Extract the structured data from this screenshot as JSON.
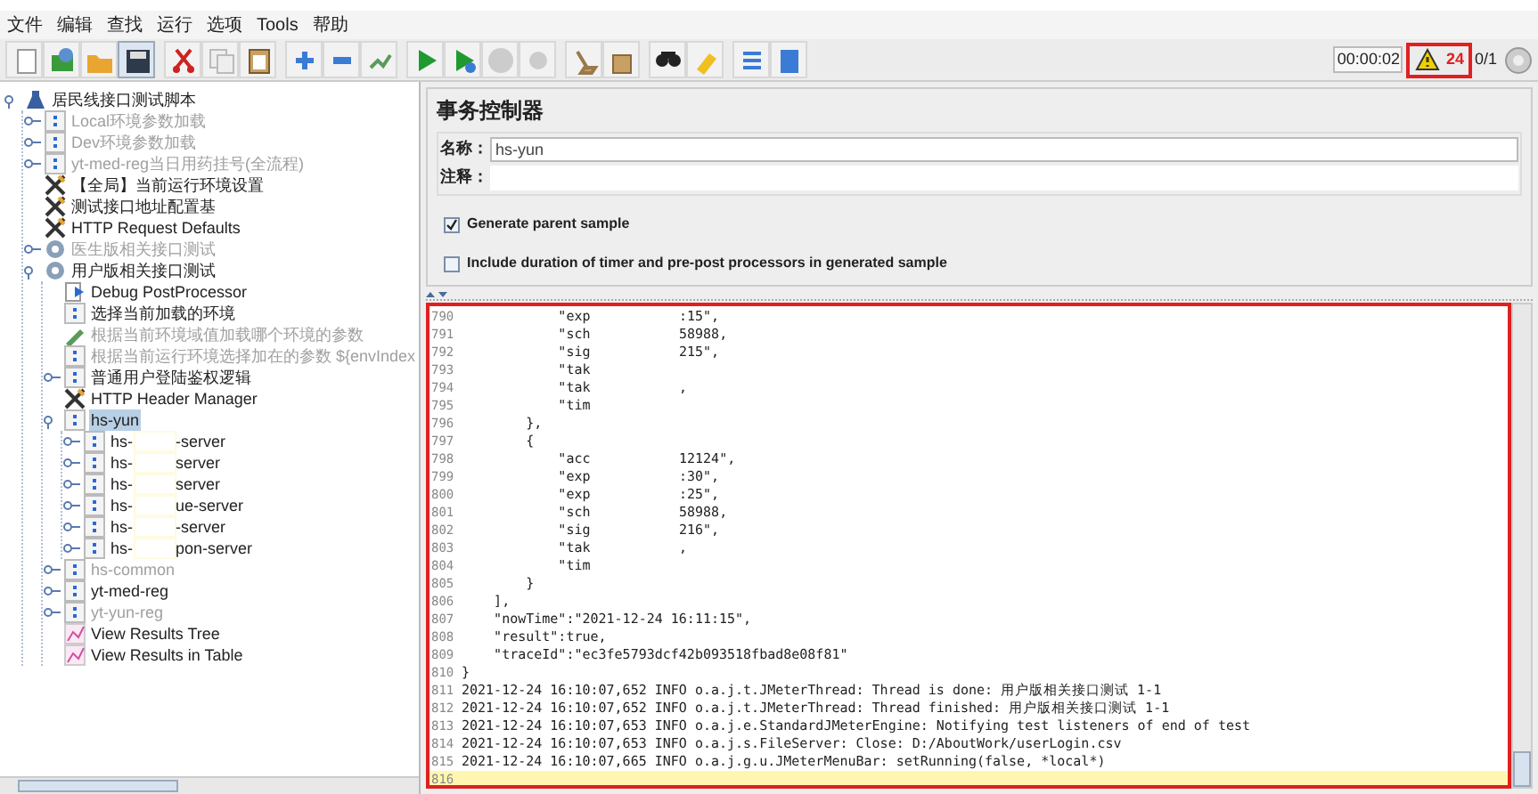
{
  "menu_bar": [
    "文件",
    "编辑",
    "查找",
    "运行",
    "选项",
    "Tools",
    "帮助"
  ],
  "toolbar": {
    "buttons": [
      {
        "kind": "new",
        "selected": false
      },
      {
        "kind": "templates",
        "selected": false
      },
      {
        "kind": "open",
        "selected": false
      },
      {
        "kind": "save",
        "selected": true
      },
      {
        "kind": "cut",
        "selected": false
      },
      {
        "kind": "copy",
        "selected": false
      },
      {
        "kind": "paste",
        "selected": false
      },
      {
        "kind": "expand",
        "selected": false
      },
      {
        "kind": "collapse",
        "selected": false
      },
      {
        "kind": "toggle",
        "selected": false
      },
      {
        "kind": "start",
        "selected": false
      },
      {
        "kind": "start_no_pause",
        "selected": false
      },
      {
        "kind": "stop",
        "selected": false
      },
      {
        "kind": "shutdown",
        "selected": false
      },
      {
        "kind": "clear",
        "selected": false
      },
      {
        "kind": "clear_all",
        "selected": false
      },
      {
        "kind": "search",
        "selected": false
      },
      {
        "kind": "reset",
        "selected": false
      },
      {
        "kind": "functions",
        "selected": false
      },
      {
        "kind": "help",
        "selected": false
      }
    ],
    "timer": "00:00:02",
    "warning_count": "24",
    "threads": "0/1"
  },
  "tree": [
    {
      "label": "居民线接口测试脚本",
      "kind": "plan",
      "enabled": true,
      "expanded": true,
      "selected": false,
      "children": [
        {
          "label": "Local环境参数加载",
          "kind": "controller",
          "enabled": false,
          "expanded": false,
          "selected": false
        },
        {
          "label": "Dev环境参数加载",
          "kind": "controller",
          "enabled": false,
          "expanded": false,
          "selected": false
        },
        {
          "label": "yt-med-reg当日用药挂号(全流程)",
          "kind": "controller",
          "enabled": false,
          "expanded": false,
          "selected": false
        },
        {
          "label": "【全局】当前运行环境设置",
          "kind": "config",
          "enabled": true,
          "selected": false
        },
        {
          "label": "测试接口地址配置基",
          "kind": "config",
          "enabled": true,
          "selected": false
        },
        {
          "label": "HTTP Request Defaults",
          "kind": "config",
          "enabled": true,
          "selected": false
        },
        {
          "label": "医生版相关接口测试",
          "kind": "threads",
          "enabled": false,
          "expanded": false,
          "selected": false
        },
        {
          "label": "用户版相关接口测试",
          "kind": "threads",
          "enabled": true,
          "expanded": true,
          "selected": false,
          "children": [
            {
              "label": "Debug PostProcessor",
              "kind": "debug",
              "enabled": true,
              "selected": false
            },
            {
              "label": "选择当前加载的环境",
              "kind": "controller",
              "enabled": true,
              "selected": false
            },
            {
              "label": "根据当前环境域值加载哪个环境的参数",
              "kind": "script",
              "enabled": false,
              "selected": false
            },
            {
              "label": "根据当前运行环境选择加在的参数 ${envIndex",
              "kind": "controller",
              "enabled": false,
              "selected": false
            },
            {
              "label": "普通用户登陆鉴权逻辑",
              "kind": "controller",
              "enabled": true,
              "expanded": false,
              "selected": false
            },
            {
              "label": "HTTP Header Manager",
              "kind": "config",
              "enabled": true,
              "selected": false
            },
            {
              "label": "hs-yun",
              "kind": "controller",
              "enabled": true,
              "expanded": true,
              "selected": true,
              "children": [
                {
                  "label": "hs-",
                  "label_tail": "-server",
                  "kind": "controller",
                  "enabled": true,
                  "expanded": false,
                  "selected": false
                },
                {
                  "label": "hs-",
                  "label_tail": "server",
                  "kind": "controller",
                  "enabled": true,
                  "expanded": false,
                  "selected": false
                },
                {
                  "label": "hs-",
                  "label_tail": "server",
                  "kind": "controller",
                  "enabled": true,
                  "expanded": false,
                  "selected": false
                },
                {
                  "label": "hs-",
                  "label_tail": "ue-server",
                  "kind": "controller",
                  "enabled": true,
                  "expanded": false,
                  "selected": false
                },
                {
                  "label": "hs-",
                  "label_tail": "-server",
                  "kind": "controller",
                  "enabled": true,
                  "expanded": false,
                  "selected": false
                },
                {
                  "label": "hs-",
                  "label_tail": "pon-server",
                  "kind": "controller",
                  "enabled": true,
                  "expanded": false,
                  "selected": false
                }
              ]
            },
            {
              "label": "hs-common",
              "kind": "controller",
              "enabled": false,
              "expanded": false,
              "selected": false
            },
            {
              "label": "yt-med-reg",
              "kind": "controller",
              "enabled": true,
              "expanded": false,
              "selected": false
            },
            {
              "label": "yt-yun-reg",
              "kind": "controller",
              "enabled": false,
              "expanded": false,
              "selected": false
            },
            {
              "label": "View Results Tree",
              "kind": "listener",
              "enabled": true,
              "selected": false
            },
            {
              "label": "View Results in Table",
              "kind": "listener",
              "enabled": true,
              "selected": false
            }
          ]
        }
      ]
    }
  ],
  "panel": {
    "title": "事务控制器",
    "name_label": "名称：",
    "name_value": "hs-yun",
    "comment_label": "注释：",
    "options": [
      {
        "label": "Generate parent sample",
        "checked": true
      },
      {
        "label": "Include duration of timer and pre-post processors in generated sample",
        "checked": false
      }
    ]
  },
  "log": [
    {
      "n": "790",
      "text": "            \"exp",
      "tail": ":15\",",
      "current": false
    },
    {
      "n": "791",
      "text": "            \"sch",
      "tail": "58988,",
      "current": false
    },
    {
      "n": "792",
      "text": "            \"sig",
      "tail": "215\",",
      "current": false
    },
    {
      "n": "793",
      "text": "            \"tak",
      "current": false
    },
    {
      "n": "794",
      "text": "            \"tak",
      "tail": ",",
      "current": false
    },
    {
      "n": "795",
      "text": "            \"tim",
      "current": false
    },
    {
      "n": "796",
      "text": "        },",
      "current": false
    },
    {
      "n": "797",
      "text": "        {",
      "current": false
    },
    {
      "n": "798",
      "text": "            \"acc",
      "tail": "12124\",",
      "current": false
    },
    {
      "n": "799",
      "text": "            \"exp",
      "tail": ":30\",",
      "current": false
    },
    {
      "n": "800",
      "text": "            \"exp",
      "tail": ":25\",",
      "current": false
    },
    {
      "n": "801",
      "text": "            \"sch",
      "tail": "58988,",
      "current": false
    },
    {
      "n": "802",
      "text": "            \"sig",
      "tail": "216\",",
      "current": false
    },
    {
      "n": "803",
      "text": "            \"tak",
      "tail": ",",
      "current": false
    },
    {
      "n": "804",
      "text": "            \"tim",
      "current": false
    },
    {
      "n": "805",
      "text": "        }",
      "current": false
    },
    {
      "n": "806",
      "text": "    ],",
      "current": false
    },
    {
      "n": "807",
      "text": "    \"nowTime\":\"2021-12-24 16:11:15\",",
      "current": false
    },
    {
      "n": "808",
      "text": "    \"result\":true,",
      "current": false
    },
    {
      "n": "809",
      "text": "    \"traceId\":\"ec3fe5793dcf42b093518fbad8e08f81\"",
      "current": false
    },
    {
      "n": "810",
      "text": "}",
      "current": false
    },
    {
      "n": "811",
      "text": "2021-12-24 16:10:07,652 INFO o.a.j.t.JMeterThread: Thread is done: 用户版相关接口测试 1-1",
      "current": false
    },
    {
      "n": "812",
      "text": "2021-12-24 16:10:07,652 INFO o.a.j.t.JMeterThread: Thread finished: 用户版相关接口测试 1-1",
      "current": false
    },
    {
      "n": "813",
      "text": "2021-12-24 16:10:07,653 INFO o.a.j.e.StandardJMeterEngine: Notifying test listeners of end of test",
      "current": false
    },
    {
      "n": "814",
      "text": "2021-12-24 16:10:07,653 INFO o.a.j.s.FileServer: Close: D:/AboutWork/userLogin.csv",
      "current": false
    },
    {
      "n": "815",
      "text": "2021-12-24 16:10:07,665 INFO o.a.j.g.u.JMeterMenuBar: setRunning(false, *local*)",
      "current": false
    },
    {
      "n": "816",
      "current": true
    }
  ]
}
